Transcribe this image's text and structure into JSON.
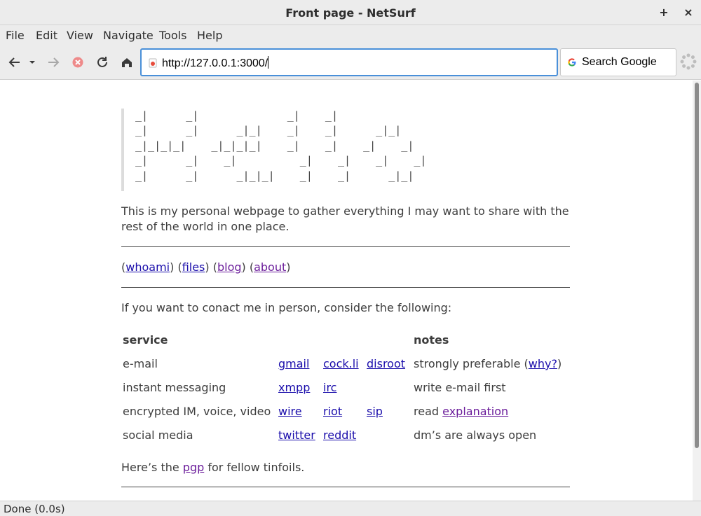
{
  "window": {
    "title": "Front page - NetSurf",
    "btn_new": "+",
    "btn_close": "×"
  },
  "menu": {
    "items": [
      "File",
      "Edit",
      "View",
      "Navigate",
      "Tools",
      "Help"
    ]
  },
  "toolbar": {
    "url": "http://127.0.0.1:3000/",
    "search_placeholder": "Search Google"
  },
  "page": {
    "ascii_art": "_|      _|              _|    _|\n_|      _|      _|_|    _|    _|      _|_|\n_|_|_|_|    _|_|_|_|    _|    _|    _|    _|\n_|      _|    _|          _|    _|    _|    _|\n_|      _|      _|_|_|    _|    _|      _|_|",
    "intro": "This is my personal webpage to gather everything I may want to share with the rest of the world in one place.",
    "nav": [
      {
        "label": "whoami",
        "visited": false
      },
      {
        "label": "files",
        "visited": false
      },
      {
        "label": "blog",
        "visited": true
      },
      {
        "label": "about",
        "visited": true
      }
    ],
    "contact_intro": "If you want to conact me in person, consider the following:",
    "table": {
      "header_service": "service",
      "header_notes": "notes",
      "rows": [
        {
          "service": "e-mail",
          "links": [
            "gmail",
            "cock.li",
            "disroot"
          ],
          "note": "strongly preferable (",
          "note_link": "why?",
          "note_after": ")"
        },
        {
          "service": "instant messaging",
          "links": [
            "xmpp",
            "irc"
          ],
          "note": "write e-mail first",
          "note_link": "",
          "note_after": ""
        },
        {
          "service": "encrypted IM, voice, video",
          "links": [
            "wire",
            "riot",
            "sip"
          ],
          "note": "read ",
          "note_link": "explanation",
          "note_after": ""
        },
        {
          "service": "social media",
          "links": [
            "twitter",
            "reddit"
          ],
          "note": "dm’s are always open",
          "note_link": "",
          "note_after": ""
        }
      ]
    },
    "pgp_before": "Here’s the ",
    "pgp_link": "pgp",
    "pgp_after": " for fellow tinfoils."
  },
  "status": {
    "text": "Done (0.0s)"
  }
}
